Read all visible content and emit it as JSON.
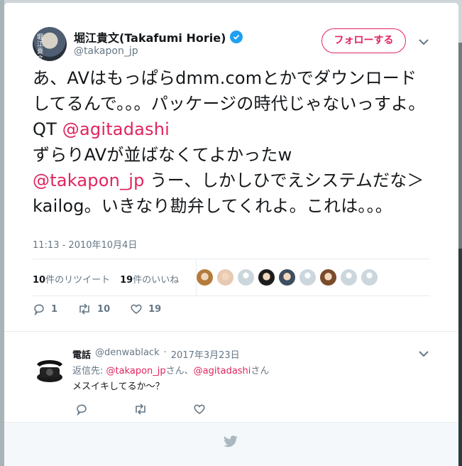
{
  "tweet": {
    "author": {
      "name": "堀江貴文(Takafumi Horie)",
      "handle": "@takapon_jp",
      "avatar_text": "堀\n江\n貴\n文"
    },
    "follow_label": "フォローする",
    "text_parts": [
      "あ、AVはもっぱらdmm.comとかでダウンロードしてるんで。。。パッケージの時代じゃないっすよ。 QT ",
      "@agitadashi",
      "ずらりAVが並ばなくてよかったw ",
      "@takapon_jp",
      " うー、しかしひでえシステムだな＞kailog。いきなり勘弁してくれよ。これは。。。"
    ],
    "timestamp": "11:13 - 2010年10月4日",
    "stats": {
      "retweets_count": "10",
      "retweets_label": "件のリツイート",
      "likes_count": "19",
      "likes_label": "件のいいね"
    },
    "actions": {
      "reply_count": "1",
      "retweet_count": "10",
      "like_count": "19"
    },
    "likers": [
      {
        "icon": "avatar-icon",
        "color": "#b37b3c"
      },
      {
        "icon": "avatar-icon",
        "color": "#e8c9b1"
      },
      {
        "icon": "default-avatar-icon",
        "color": "#ccd6dd"
      },
      {
        "icon": "avatar-icon",
        "color": "#1d1d1d"
      },
      {
        "icon": "avatar-icon",
        "color": "#3c4e5f"
      },
      {
        "icon": "default-avatar-icon",
        "color": "#ccd6dd"
      },
      {
        "icon": "avatar-icon",
        "color": "#7a4b2b"
      },
      {
        "icon": "default-avatar-icon",
        "color": "#ccd6dd"
      },
      {
        "icon": "default-avatar-icon",
        "color": "#ccd6dd"
      }
    ]
  },
  "reply": {
    "name": "電話",
    "handle": "@denwablack",
    "separator": "·",
    "date": "2017年3月23日",
    "reply_to_prefix": "返信先: ",
    "reply_to_user1": "@takapon_jp",
    "reply_to_mid": "さん、",
    "reply_to_user2": "@agitadashi",
    "reply_to_suffix": "さん",
    "text": "メスイキしてるか～？"
  },
  "colors": {
    "accent": "#e0245e",
    "verified": "#1da1f2",
    "muted": "#657786"
  }
}
